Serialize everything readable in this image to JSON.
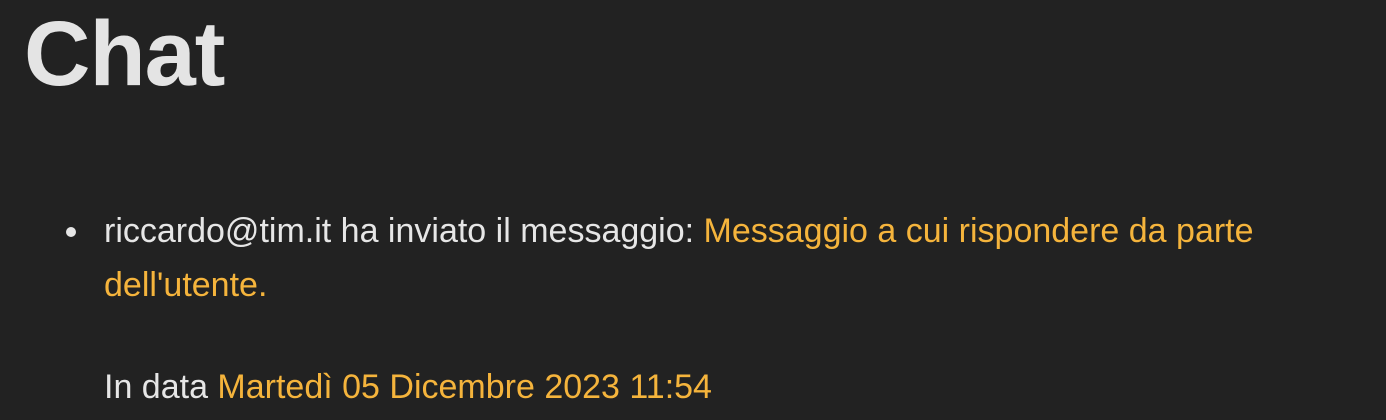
{
  "page": {
    "title": "Chat"
  },
  "message": {
    "sender": "riccardo@tim.it",
    "sent_text": " ha inviato il messaggio: ",
    "content": "Messaggio a cui rispondere da parte dell'utente.",
    "date_prefix": "In data ",
    "date_value": "Martedì 05 Dicembre 2023 11:54"
  },
  "colors": {
    "background": "#222222",
    "text": "#e6e6e6",
    "accent": "#f5b43c"
  }
}
